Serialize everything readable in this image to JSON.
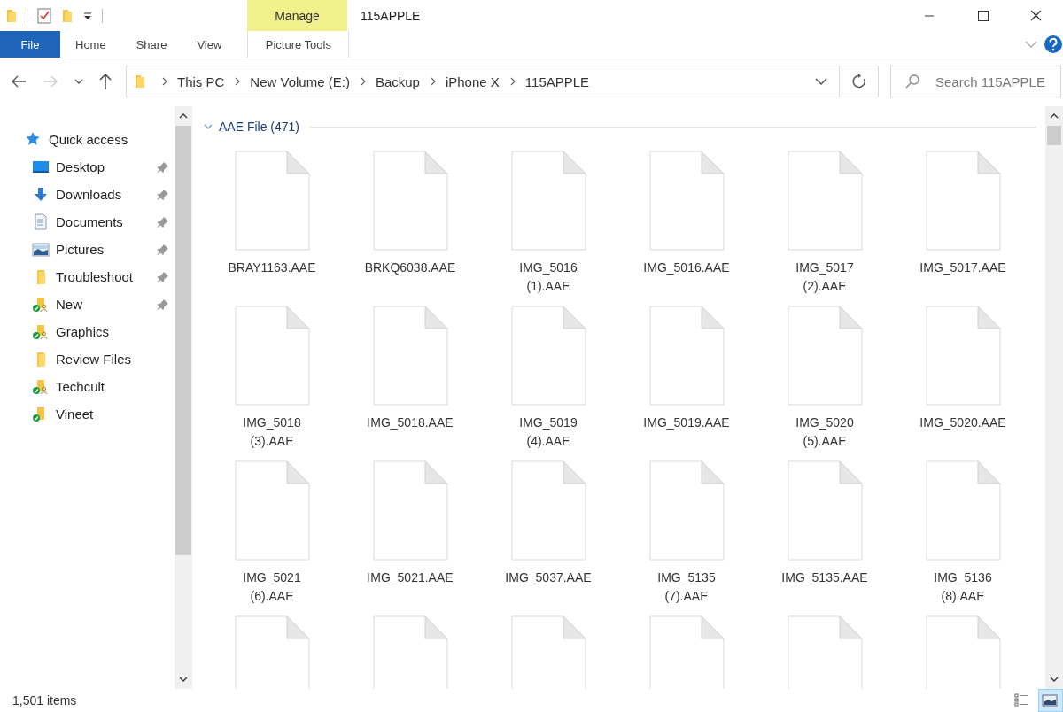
{
  "window": {
    "title": "115APPLE"
  },
  "ribbon": {
    "contextual_group": "Manage",
    "tabs": [
      {
        "label": "File",
        "kind": "file"
      },
      {
        "label": "Home",
        "kind": "tab"
      },
      {
        "label": "Share",
        "kind": "tab"
      },
      {
        "label": "View",
        "kind": "tab"
      },
      {
        "label": "Picture Tools",
        "kind": "contextual"
      }
    ]
  },
  "address": {
    "breadcrumb": [
      "This PC",
      "New Volume (E:)",
      "Backup",
      "iPhone X",
      "115APPLE"
    ]
  },
  "search": {
    "placeholder": "Search 115APPLE"
  },
  "sidebar": {
    "items": [
      {
        "label": "Quick access",
        "kind": "quickaccess",
        "pinned": false
      },
      {
        "label": "Desktop",
        "kind": "desktop",
        "pinned": true
      },
      {
        "label": "Downloads",
        "kind": "downloads",
        "pinned": true
      },
      {
        "label": "Documents",
        "kind": "documents",
        "pinned": true
      },
      {
        "label": "Pictures",
        "kind": "pictures",
        "pinned": true
      },
      {
        "label": "Troubleshoot",
        "kind": "folder",
        "pinned": true
      },
      {
        "label": "New",
        "kind": "shared",
        "pinned": true
      },
      {
        "label": "Graphics",
        "kind": "shared",
        "pinned": false
      },
      {
        "label": "Review Files",
        "kind": "folder",
        "pinned": false
      },
      {
        "label": "Techcult",
        "kind": "shared",
        "pinned": false
      },
      {
        "label": "Vineet",
        "kind": "synced",
        "pinned": false
      }
    ]
  },
  "content": {
    "group": {
      "title": "AAE File (471)",
      "expanded": true
    },
    "files": [
      {
        "kind": "file",
        "name": "BRAY1163.AAE"
      },
      {
        "kind": "file",
        "name": "BRKQ6038.AAE"
      },
      {
        "kind": "file",
        "name": "IMG_5016 (1).AAE"
      },
      {
        "kind": "file",
        "name": "IMG_5016.AAE"
      },
      {
        "kind": "file",
        "name": "IMG_5017 (2).AAE"
      },
      {
        "kind": "file",
        "name": "IMG_5017.AAE"
      },
      {
        "kind": "file",
        "name": "IMG_5018 (3).AAE"
      },
      {
        "kind": "file",
        "name": "IMG_5018.AAE"
      },
      {
        "kind": "file",
        "name": "IMG_5019 (4).AAE"
      },
      {
        "kind": "file",
        "name": "IMG_5019.AAE"
      },
      {
        "kind": "file",
        "name": "IMG_5020 (5).AAE"
      },
      {
        "kind": "file",
        "name": "IMG_5020.AAE"
      },
      {
        "kind": "file",
        "name": "IMG_5021 (6).AAE"
      },
      {
        "kind": "file",
        "name": "IMG_5021.AAE"
      },
      {
        "kind": "file",
        "name": "IMG_5037.AAE"
      },
      {
        "kind": "file",
        "name": "IMG_5135 (7).AAE"
      },
      {
        "kind": "file",
        "name": "IMG_5135.AAE"
      },
      {
        "kind": "file",
        "name": "IMG_5136 (8).AAE"
      },
      {
        "kind": "partial"
      },
      {
        "kind": "partial"
      },
      {
        "kind": "partial"
      },
      {
        "kind": "partial"
      },
      {
        "kind": "partial"
      },
      {
        "kind": "partial"
      }
    ]
  },
  "status_bar": {
    "count": "1,501 items",
    "views": [
      {
        "kind": "details",
        "selected": false
      },
      {
        "kind": "large-icons",
        "selected": true
      }
    ]
  }
}
